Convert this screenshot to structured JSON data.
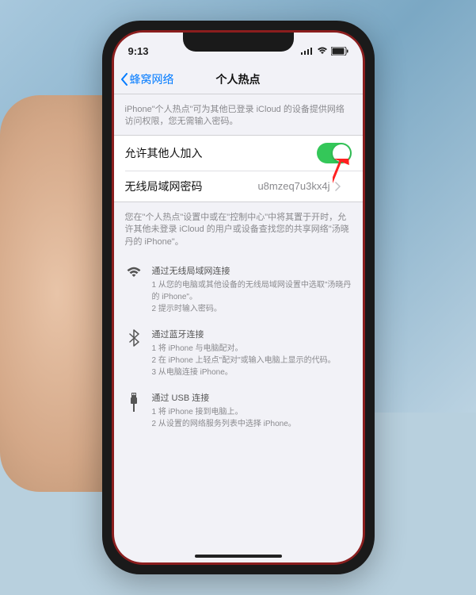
{
  "statusBar": {
    "time": "9:13",
    "signalIcon": "signal-icon",
    "wifiIcon": "wifi-icon",
    "batteryIcon": "battery-icon"
  },
  "nav": {
    "backLabel": "蜂窝网络",
    "title": "个人热点"
  },
  "topDescription": "iPhone\"个人热点\"可为其他已登录 iCloud 的设备提供网络访问权限，您无需输入密码。",
  "cells": {
    "allowOthers": {
      "label": "允许其他人加入",
      "toggleOn": true
    },
    "password": {
      "label": "无线局域网密码",
      "value": "u8mzeq7u3kx4j"
    }
  },
  "midDescription": "您在\"个人热点\"设置中或在\"控制中心\"中将其置于开时，允许其他未登录 iCloud 的用户或设备查找您的共享网络\"汤晓丹的 iPhone\"。",
  "instructions": {
    "wifi": {
      "title": "通过无线局域网连接",
      "steps": [
        "1 从您的电脑或其他设备的无线局域网设置中选取\"汤晓丹的 iPhone\"。",
        "2 提示时输入密码。"
      ]
    },
    "bluetooth": {
      "title": "通过蓝牙连接",
      "steps": [
        "1 将 iPhone 与电脑配对。",
        "2 在 iPhone 上轻点\"配对\"或输入电脑上显示的代码。",
        "3 从电脑连接 iPhone。"
      ]
    },
    "usb": {
      "title": "通过 USB 连接",
      "steps": [
        "1 将 iPhone 接到电脑上。",
        "2 从设置的网络服务列表中选择 iPhone。"
      ]
    }
  }
}
